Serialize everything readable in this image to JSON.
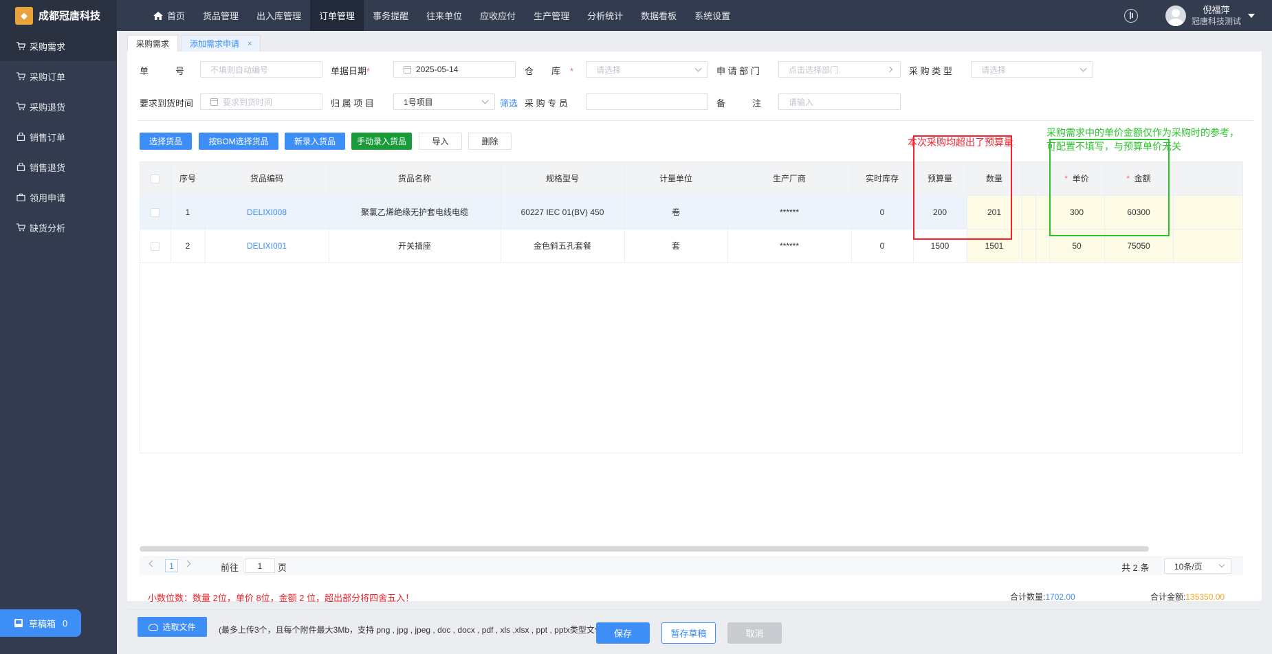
{
  "app": {
    "brand": "成都冠唐科技"
  },
  "topnav": [
    {
      "label": "首页",
      "active": false
    },
    {
      "label": "货品管理",
      "active": false
    },
    {
      "label": "出入库管理",
      "active": false
    },
    {
      "label": "订单管理",
      "active": true
    },
    {
      "label": "事务提醒",
      "active": false
    },
    {
      "label": "往来单位",
      "active": false
    },
    {
      "label": "应收应付",
      "active": false
    },
    {
      "label": "生产管理",
      "active": false
    },
    {
      "label": "分析统计",
      "active": false
    },
    {
      "label": "数据看板",
      "active": false
    },
    {
      "label": "系统设置",
      "active": false
    }
  ],
  "user": {
    "name": "倪福萍",
    "org": "冠唐科技测试"
  },
  "sidebar": {
    "items": [
      {
        "label": "采购需求",
        "active": true
      },
      {
        "label": "采购订单",
        "active": false
      },
      {
        "label": "采购退货",
        "active": false
      },
      {
        "label": "销售订单",
        "active": false
      },
      {
        "label": "销售退货",
        "active": false
      },
      {
        "label": "领用申请",
        "active": false
      },
      {
        "label": "缺货分析",
        "active": false
      }
    ],
    "drafts_label": "草稿箱",
    "drafts_count": "0"
  },
  "tabs": [
    {
      "label": "采购需求",
      "active": false
    },
    {
      "label": "添加需求申请",
      "active": true,
      "close": "×"
    }
  ],
  "form": {
    "doc_no_label": "单　　　号",
    "doc_no_placeholder": "不填则自动编号",
    "doc_date_label": "单据日期",
    "doc_date_value": "2025-05-14",
    "warehouse_label": "仓　　库",
    "warehouse_placeholder": "请选择",
    "dept_label": "申 请 部 门",
    "dept_placeholder": "点击选择部门",
    "ptype_label": "采 购 类 型",
    "ptype_placeholder": "请选择",
    "arrival_label": "要求到货时间",
    "arrival_placeholder": "要求到货时间",
    "project_label": "归 属 项 目",
    "project_value": "1号项目",
    "filter_link": "筛选",
    "buyer_label": "采 购 专 员",
    "buyer_value": "",
    "remark_label": "备　　　注",
    "remark_placeholder": "请输入",
    "required_mark": "*"
  },
  "toolbar": {
    "select_goods": "选择货品",
    "bom_select": "按BOM选择货品",
    "new_goods": "新录入货品",
    "manual_goods": "手动录入货品",
    "import": "导入",
    "delete": "删除"
  },
  "annotations": {
    "red": "本次采购均超出了预算量",
    "green_line1": "采购需求中的单价金额仅作为采购时的参考，",
    "green_line2": "可配置不填写，与预算单价无关"
  },
  "table": {
    "headers": [
      "序号",
      "货品编码",
      "货品名称",
      "规格型号",
      "计量单位",
      "生产厂商",
      "实时库存",
      "预算量",
      "数量",
      "单价",
      "金额"
    ],
    "rows": [
      {
        "no": "1",
        "code": "DELIXI008",
        "name": "聚氯乙烯绝缘无护套电线电缆",
        "spec": "60227 IEC 01(BV) 450",
        "unit": "卷",
        "maker": "******",
        "stock": "0",
        "budget": "200",
        "qty": "201",
        "price": "300",
        "amount": "60300"
      },
      {
        "no": "2",
        "code": "DELIXI001",
        "name": "开关插座",
        "spec": "金色斜五孔套餐",
        "unit": "套",
        "maker": "******",
        "stock": "0",
        "budget": "1500",
        "qty": "1501",
        "price": "50",
        "amount": "75050"
      }
    ]
  },
  "pager": {
    "current": "1",
    "goto_label": "前往",
    "goto_value": "1",
    "page_suffix": "页",
    "total": "共 2 条",
    "size": "10条/页"
  },
  "summary": {
    "decimal_note": "小数位数：数量 2位，单价 8位，金额 2 位，超出部分将四舍五入！",
    "total_qty_label": "合计数量:",
    "total_qty": "1702.00",
    "total_amount_label": "合计金额:",
    "total_amount": "135350.00"
  },
  "upload": {
    "button": "选取文件",
    "hint": "(最多上传3个，且每个附件最大3Mb，支持 png , jpg , jpeg , doc , docx , pdf , xls ,xlsx , ppt , pptx类型文件)"
  },
  "footer": {
    "save": "保存",
    "draft": "暂存草稿",
    "cancel": "取消"
  },
  "colors": {
    "primary": "#3e8ef7",
    "sidebar": "#333c4f",
    "green_btn": "#1a9b3a",
    "red_note": "#f5222d",
    "green_note": "#2bc32b"
  }
}
